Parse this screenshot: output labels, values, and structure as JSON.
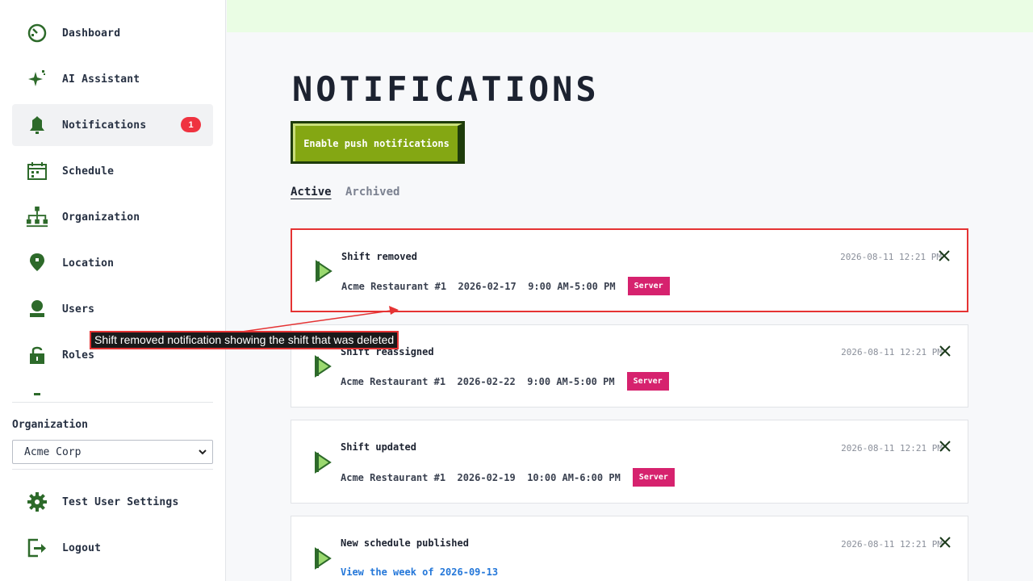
{
  "sidebar": {
    "items": [
      {
        "label": "Dashboard",
        "icon": "dashboard-icon"
      },
      {
        "label": "AI Assistant",
        "icon": "sparkle-icon"
      },
      {
        "label": "Notifications",
        "icon": "bell-icon",
        "badge": "1",
        "active": true
      },
      {
        "label": "Schedule",
        "icon": "calendar-icon"
      },
      {
        "label": "Organization",
        "icon": "org-chart-icon"
      },
      {
        "label": "Location",
        "icon": "location-pin-icon"
      },
      {
        "label": "Users",
        "icon": "user-icon"
      },
      {
        "label": "Roles",
        "icon": "lock-icon"
      }
    ],
    "organization_label": "Organization",
    "organization_selected": "Acme Corp",
    "footer_items": [
      {
        "label": "Test User Settings",
        "icon": "gear-icon"
      },
      {
        "label": "Logout",
        "icon": "logout-icon"
      }
    ]
  },
  "main": {
    "title": "NOTIFICATIONS",
    "push_button": "Enable push notifications",
    "tabs": [
      {
        "label": "Active",
        "active": true
      },
      {
        "label": "Archived",
        "active": false
      }
    ],
    "notifications": [
      {
        "title": "Shift removed",
        "location": "Acme Restaurant #1",
        "date": "2026-02-17",
        "time": "9:00 AM-5:00 PM",
        "role": "Server",
        "timestamp": "2026-08-11 12:21 PM"
      },
      {
        "title": "Shift reassigned",
        "location": "Acme Restaurant #1",
        "date": "2026-02-22",
        "time": "9:00 AM-5:00 PM",
        "role": "Server",
        "timestamp": "2026-08-11 12:21 PM"
      },
      {
        "title": "Shift updated",
        "location": "Acme Restaurant #1",
        "date": "2026-02-19",
        "time": "10:00 AM-6:00 PM",
        "role": "Server",
        "timestamp": "2026-08-11 12:21 PM"
      },
      {
        "title": "New schedule published",
        "link": "View the week of 2026-09-13",
        "timestamp": "2026-08-11 12:21 PM"
      }
    ]
  },
  "annotation": {
    "text": "Shift removed notification showing the shift that was deleted"
  },
  "colors": {
    "accent": "#84a713",
    "badge": "#ef3340",
    "role_tag": "#d6226e",
    "highlight": "#e53333",
    "link": "#2477d9"
  }
}
